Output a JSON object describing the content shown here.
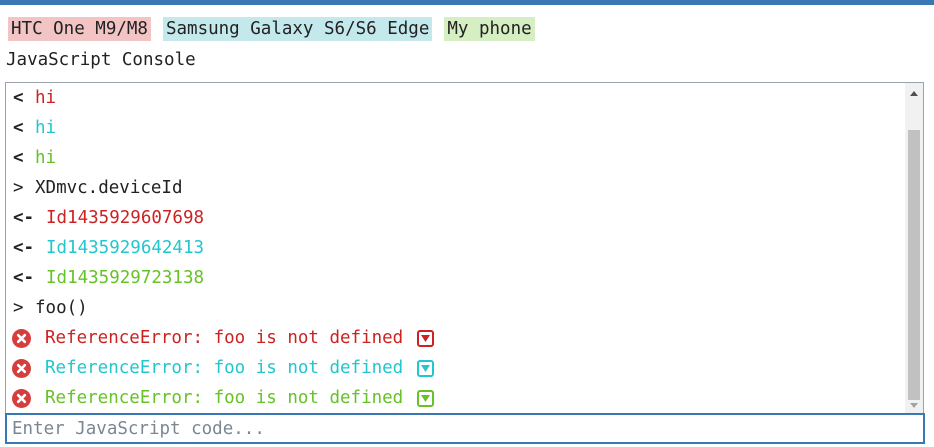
{
  "devices": [
    {
      "label": "HTC One M9/M8",
      "bg": "#f3c4c4",
      "color": "#cc2222"
    },
    {
      "label": "Samsung Galaxy S6/S6 Edge",
      "bg": "#c4e9ec",
      "color": "#22c6cf"
    },
    {
      "label": "My phone",
      "bg": "#d5eec2",
      "color": "#66c226"
    }
  ],
  "console": {
    "title": "JavaScript Console",
    "input_placeholder": "Enter JavaScript code...",
    "lines": [
      {
        "kind": "output",
        "prefix": "<",
        "text": "hi",
        "device": 0
      },
      {
        "kind": "output",
        "prefix": "<",
        "text": "hi",
        "device": 1
      },
      {
        "kind": "output",
        "prefix": "<",
        "text": "hi",
        "device": 2
      },
      {
        "kind": "input",
        "prefix": ">",
        "text": "XDmvc.deviceId"
      },
      {
        "kind": "result",
        "prefix": "<-",
        "text": "Id1435929607698",
        "device": 0
      },
      {
        "kind": "result",
        "prefix": "<-",
        "text": "Id1435929642413",
        "device": 1
      },
      {
        "kind": "result",
        "prefix": "<-",
        "text": "Id1435929723138",
        "device": 2
      },
      {
        "kind": "input",
        "prefix": ">",
        "text": "foo()"
      },
      {
        "kind": "error",
        "text": "ReferenceError: foo is not defined",
        "device": 0
      },
      {
        "kind": "error",
        "text": "ReferenceError: foo is not defined",
        "device": 1
      },
      {
        "kind": "error",
        "text": "ReferenceError: foo is not defined",
        "device": 2
      }
    ]
  },
  "icons": {
    "error": "error-circle-icon",
    "expand": "chevron-down-box-icon",
    "scroll_up": "arrow-up-icon",
    "scroll_down": "arrow-down-icon"
  },
  "colors": {
    "accent": "#3a78b5",
    "error_icon": "#d63e3e"
  }
}
